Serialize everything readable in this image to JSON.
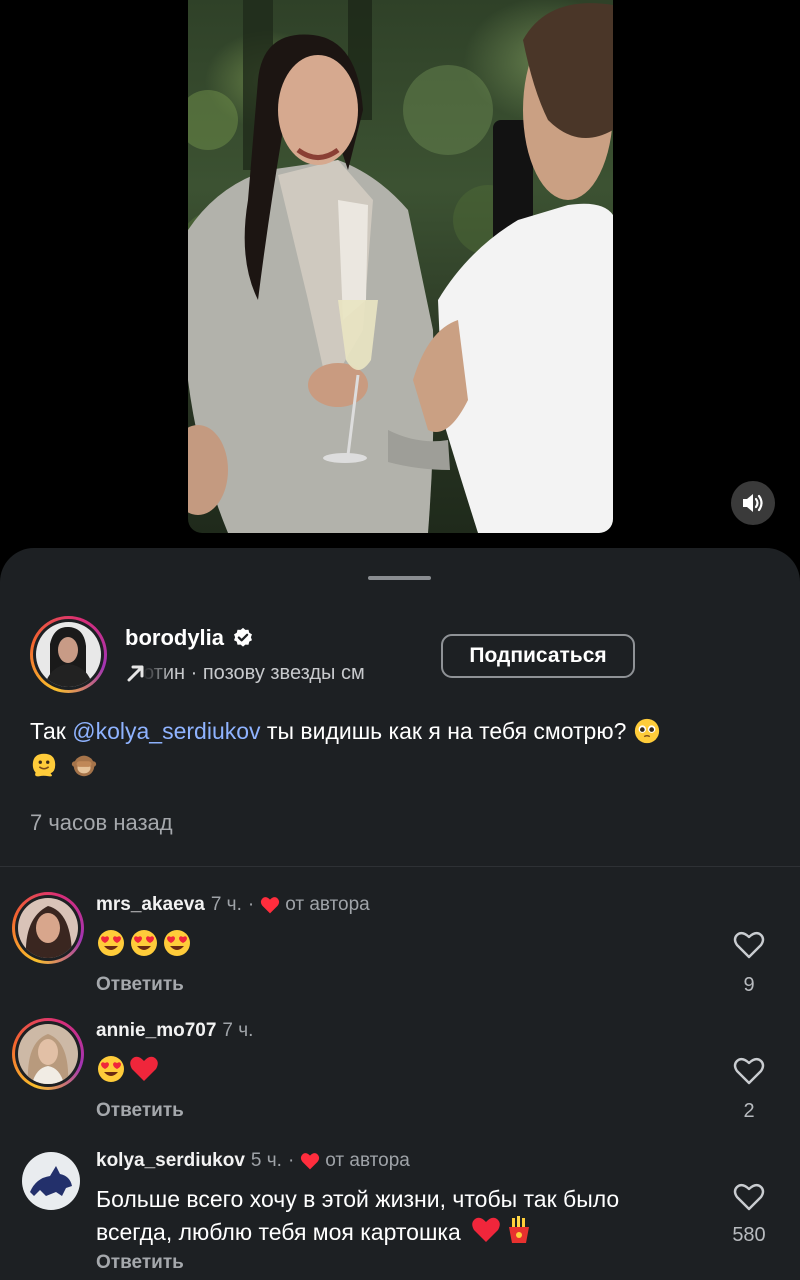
{
  "video": {
    "sound_icon": "speaker-icon"
  },
  "post": {
    "author": "borodylia",
    "verified_icon": "verified-badge-icon",
    "audio_text": "отин · позову звезды см",
    "follow_label": "Подписаться",
    "caption_prefix": "Так ",
    "caption_mention": "@kolya_serdiukov",
    "caption_suffix": " ты видишь как я на тебя смотрю?",
    "caption_emojis": [
      "pleading-face",
      "melting-face",
      "see-no-evil-monkey"
    ],
    "time": "7 часов назад"
  },
  "comments": [
    {
      "user": "mrs_akaeva",
      "time": "7 ч.",
      "sep": "·",
      "by_author": true,
      "by_author_label": "от автора",
      "text": "",
      "emojis": [
        "heart-eyes",
        "heart-eyes",
        "heart-eyes"
      ],
      "reply_label": "Ответить",
      "likes": "9"
    },
    {
      "user": "annie_mo707",
      "time": "7 ч.",
      "sep": "",
      "by_author": false,
      "by_author_label": "",
      "text": "",
      "emojis": [
        "heart-eyes",
        "red-heart"
      ],
      "reply_label": "Ответить",
      "likes": "2"
    },
    {
      "user": "kolya_serdiukov",
      "time": "5 ч.",
      "sep": "·",
      "by_author": true,
      "by_author_label": "от автора",
      "text": "Больше всего хочу в этой жизни, чтобы так было всегда, люблю тебя моя картошка",
      "emojis": [
        "red-heart",
        "french-fries"
      ],
      "reply_label": "Ответить",
      "likes": "580"
    }
  ],
  "colors": {
    "sheet_bg": "#1d2023",
    "mention": "#8fb3ff",
    "heart": "#ff2d3d"
  }
}
